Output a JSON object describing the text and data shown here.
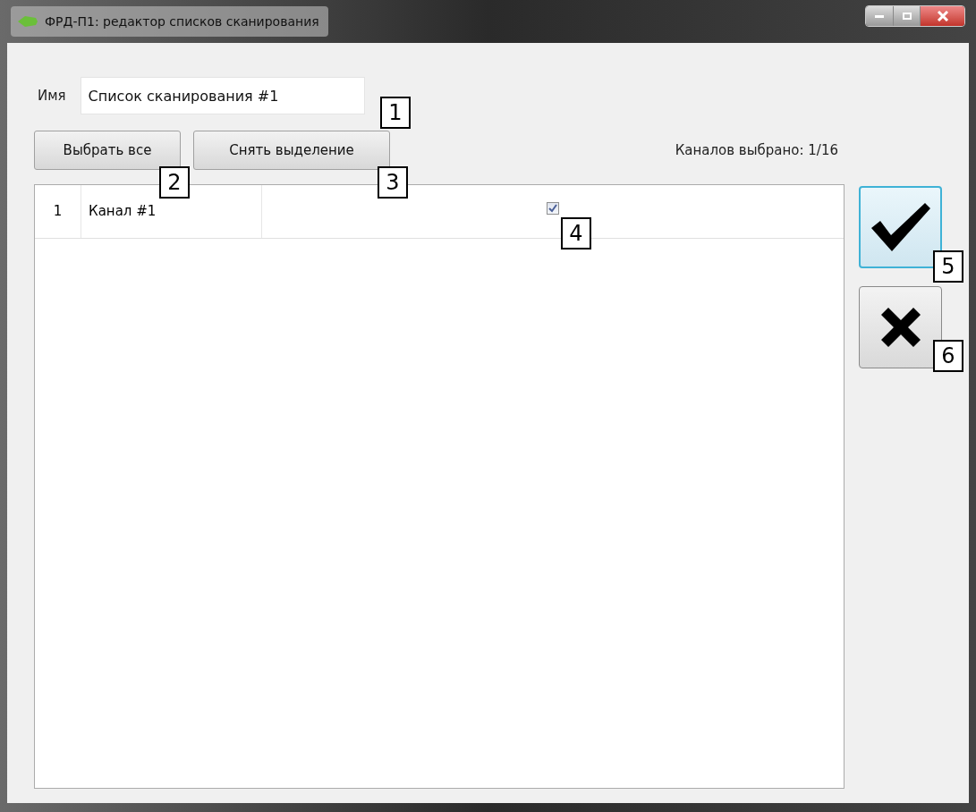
{
  "window": {
    "title": "ФРД-П1: редактор списков сканирования"
  },
  "name_field": {
    "label": "Имя",
    "value": "Список сканирования #1"
  },
  "toolbar_buttons": [
    "Выбрать все",
    "Снять выделение"
  ],
  "selected_count": "Каналов выбрано: 1/16",
  "table": {
    "rows": [
      {
        "number": "1",
        "name": "Канал #1",
        "checked": true
      }
    ]
  },
  "side_buttons": [
    {
      "kind": "confirm",
      "focused": true
    },
    {
      "kind": "cancel",
      "focused": false
    }
  ],
  "callouts": [
    "1",
    "2",
    "3",
    "4",
    "5",
    "6"
  ]
}
